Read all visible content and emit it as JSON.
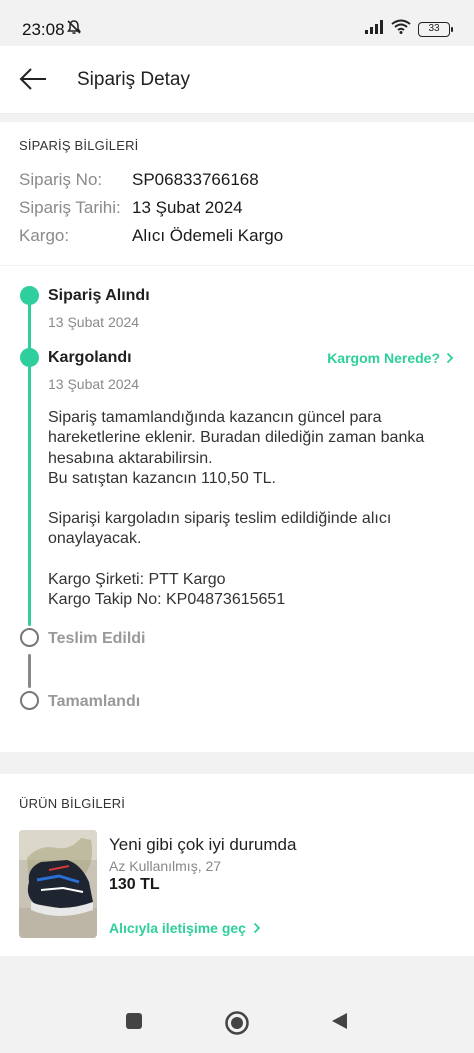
{
  "status_bar": {
    "time": "23:08",
    "battery": "33"
  },
  "header": {
    "title": "Sipariş Detay"
  },
  "order_info": {
    "heading": "SİPARİŞ BİLGİLERİ",
    "rows": [
      {
        "label": "Sipariş No:",
        "value": "SP06833766168"
      },
      {
        "label": "Sipariş Tarihi:",
        "value": "13 Şubat 2024"
      },
      {
        "label": "Kargo:",
        "value": "Alıcı Ödemeli Kargo"
      }
    ]
  },
  "timeline": {
    "steps": [
      {
        "title": "Sipariş Alındı",
        "date": "13 Şubat 2024",
        "done": true
      },
      {
        "title": "Kargolandı",
        "date": "13 Şubat 2024",
        "done": true,
        "link": "Kargom Nerede?"
      },
      {
        "title": "Teslim Edildi",
        "done": false
      },
      {
        "title": "Tamamlandı",
        "done": false
      }
    ],
    "details": {
      "line1": "Sipariş tamamlandığında kazancın güncel para",
      "line2": "hareketlerine eklenir. Buradan dilediğin zaman banka",
      "line3": "hesabına aktarabilirsin.",
      "line4": "Bu satıştan kazancın 110,50 TL.",
      "line5": "Siparişi kargoladın sipariş teslim edildiğinde alıcı",
      "line6": "onaylayacak.",
      "line7": "Kargo Şirketi: PTT Kargo",
      "line8": "Kargo Takip No: KP04873615651"
    }
  },
  "product": {
    "heading": "ÜRÜN BİLGİLERİ",
    "title": "Yeni gibi çok iyi durumda",
    "condition": "Az Kullanılmış, 27",
    "price": "130 TL",
    "contact": "Alıcıyla iletişime geç"
  },
  "colors": {
    "accent": "#2ecf9c",
    "muted": "#999999",
    "background": "#f2f2f2"
  },
  "icons": {
    "back": "arrow-left-icon",
    "chevron": "chevron-right-icon",
    "bell_muted": "bell-off-icon",
    "nav": [
      "square-icon",
      "circle-icon",
      "triangle-back-icon"
    ]
  }
}
